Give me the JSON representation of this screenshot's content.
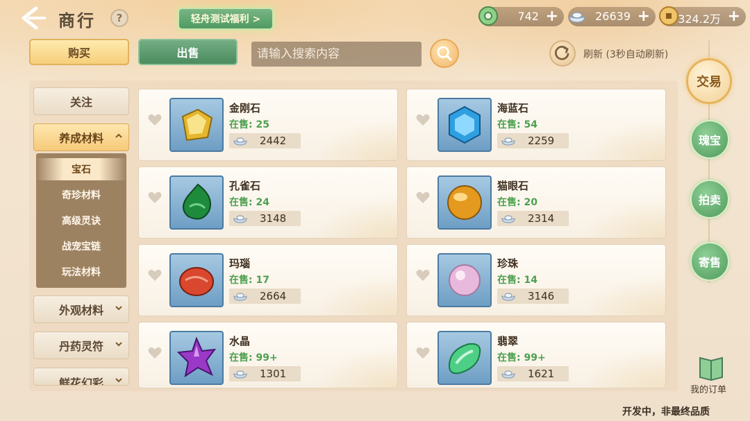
{
  "header": {
    "title": "商行",
    "help": "?",
    "event_banner": "轻舟测试福利 >"
  },
  "currencies": [
    {
      "icon": "jade-coin-icon",
      "value": "742",
      "plus": "+"
    },
    {
      "icon": "silver-ingot-icon",
      "value": "26639",
      "plus": "+"
    },
    {
      "icon": "copper-coin-icon",
      "value": "324.2万",
      "plus": "+"
    }
  ],
  "toolbar": {
    "buy_label": "购买",
    "sell_label": "出售",
    "search_placeholder": "请输入搜索内容",
    "refresh_label": "刷新 (3秒自动刷新)"
  },
  "categories": [
    {
      "label": "关注"
    },
    {
      "label": "养成材料"
    },
    {
      "label": "外观材料"
    },
    {
      "label": "丹药灵符"
    },
    {
      "label": "鲜花幻彩"
    }
  ],
  "subcategories": [
    {
      "label": "宝石"
    },
    {
      "label": "奇珍材料"
    },
    {
      "label": "高级灵诀"
    },
    {
      "label": "战宠宝链"
    },
    {
      "label": "玩法材料"
    }
  ],
  "items": [
    {
      "name": "金刚石",
      "stock": "在售: 25",
      "price": "2442",
      "icon": "yellow-diamond-gem-icon",
      "color": "#e6b62e"
    },
    {
      "name": "海蓝石",
      "stock": "在售: 54",
      "price": "2259",
      "icon": "blue-hexagon-gem-icon",
      "color": "#2f9fe0"
    },
    {
      "name": "孔雀石",
      "stock": "在售: 24",
      "price": "3148",
      "icon": "malachite-gem-icon",
      "color": "#1e8a3c"
    },
    {
      "name": "猫眼石",
      "stock": "在售: 20",
      "price": "2314",
      "icon": "cats-eye-gem-icon",
      "color": "#e39a1e"
    },
    {
      "name": "玛瑙",
      "stock": "在售: 17",
      "price": "2664",
      "icon": "agate-gem-icon",
      "color": "#d9482e"
    },
    {
      "name": "珍珠",
      "stock": "在售: 14",
      "price": "3146",
      "icon": "pearl-icon",
      "color": "#e9b9dd"
    },
    {
      "name": "水晶",
      "stock": "在售: 99+",
      "price": "1301",
      "icon": "purple-crystal-icon",
      "color": "#9a38c8"
    },
    {
      "name": "翡翠",
      "stock": "在售: 99+",
      "price": "1621",
      "icon": "jade-gem-icon",
      "color": "#4ecf86"
    }
  ],
  "side_nav": {
    "trade": "交易",
    "treasure": "瑰宝",
    "auction": "拍卖",
    "consign": "寄售",
    "my_orders": "我的订单"
  },
  "footer_note": "开发中，非最终品质"
}
